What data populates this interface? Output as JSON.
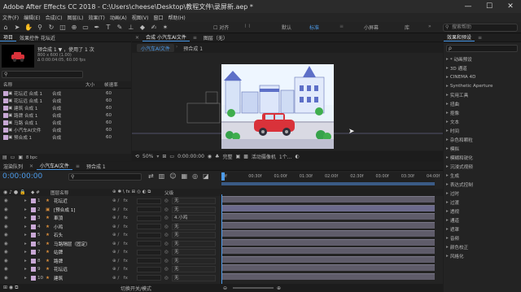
{
  "window": {
    "title": "Adobe After Effects CC 2018 - C:\\Users\\cheese\\Desktop\\教程文件\\录屏新.aep *",
    "controls": [
      "—",
      "☐",
      "✕"
    ]
  },
  "menu": [
    "文件(F)",
    "编辑(E)",
    "合成(C)",
    "图层(L)",
    "效果(T)",
    "动画(A)",
    "视图(V)",
    "窗口",
    "帮助(H)"
  ],
  "toolbar": {
    "snap_label": "对齐",
    "workspaces": [
      "默认",
      "标准",
      "小屏幕",
      "库"
    ],
    "active_workspace": "标准",
    "search_placeholder": "搜索帮助"
  },
  "project": {
    "tabs": [
      "项目",
      "效果控件 花坛近"
    ],
    "preview_name": "预合成 1 ▼ ，使用了 1 次",
    "preview_info": [
      "800 x 600 (1.00)",
      "Δ 0:00:04:05, 60.00 fps"
    ],
    "columns": [
      "名称",
      "大小",
      "帧速率"
    ],
    "items": [
      {
        "name": "花坛近 合成 1",
        "type": "合成",
        "fps": "60"
      },
      {
        "name": "花坛远 合成 1",
        "type": "合成",
        "fps": "60"
      },
      {
        "name": "建筑 合成 1",
        "type": "合成",
        "fps": "60"
      },
      {
        "name": "路牌 合成 1",
        "type": "合成",
        "fps": "60"
      },
      {
        "name": "马路 合成 1",
        "type": "合成",
        "fps": "60"
      },
      {
        "name": "小汽车AI文件",
        "type": "合成",
        "fps": "60"
      },
      {
        "name": "预合成 1",
        "type": "合成",
        "fps": "60"
      }
    ],
    "bpc": "8 bpc"
  },
  "composition": {
    "tab_label": "合成 小汽车AI文件",
    "layer_tab": "图层（无）",
    "crumbs": [
      "小汽车AI文件",
      "预合成 1"
    ],
    "zoom": "50%",
    "timecode": "0:00:00:00",
    "quality": "完整",
    "camera": "活动摄像机",
    "views": "1个..."
  },
  "effects": {
    "title": "效果和预设",
    "search_placeholder": "ρ",
    "items": [
      "* 动画预设",
      "3D 通道",
      "CINEMA 4D",
      "Synthetic Aperture",
      "实用工具",
      "扭曲",
      "抠像",
      "文本",
      "时间",
      "杂色和颗粒",
      "模拟",
      "模糊和锐化",
      "沉浸式视频",
      "生成",
      "表达式控制",
      "过时",
      "过渡",
      "透视",
      "通道",
      "遮罩",
      "音频",
      "颜色校正",
      "风格化"
    ]
  },
  "render": {
    "label": "渲染队列"
  },
  "timeline": {
    "tabs": [
      "小汽车AI文件",
      "预合成 1"
    ],
    "timecode": "0:00:00:00",
    "ruler": [
      "0f",
      "00:30f",
      "01:00f",
      "01:30f",
      "02:00f",
      "02:30f",
      "03:00f",
      "03:30f",
      "04:00f"
    ],
    "col_name": "图层名称",
    "col_parent": "父级",
    "layers": [
      {
        "num": "1",
        "name": "花坛近",
        "parent": "无",
        "star": true
      },
      {
        "num": "2",
        "name": "[预合成 1]",
        "parent": "无",
        "star": false
      },
      {
        "num": "3",
        "name": "車頂",
        "parent": "4.小鸡",
        "star": true
      },
      {
        "num": "4",
        "name": "小鸡",
        "parent": "无",
        "star": true
      },
      {
        "num": "5",
        "name": "石头",
        "parent": "无",
        "star": true
      },
      {
        "num": "6",
        "name": "马路隔层（固定）",
        "parent": "无",
        "star": true
      },
      {
        "num": "7",
        "name": "站牌",
        "parent": "无",
        "star": true
      },
      {
        "num": "8",
        "name": "路牌",
        "parent": "无",
        "star": true
      },
      {
        "num": "9",
        "name": "花坛远",
        "parent": "无",
        "star": true
      },
      {
        "num": "10",
        "name": "建筑",
        "parent": "无",
        "star": true
      }
    ],
    "toggle_label": "切换开关/模式"
  }
}
